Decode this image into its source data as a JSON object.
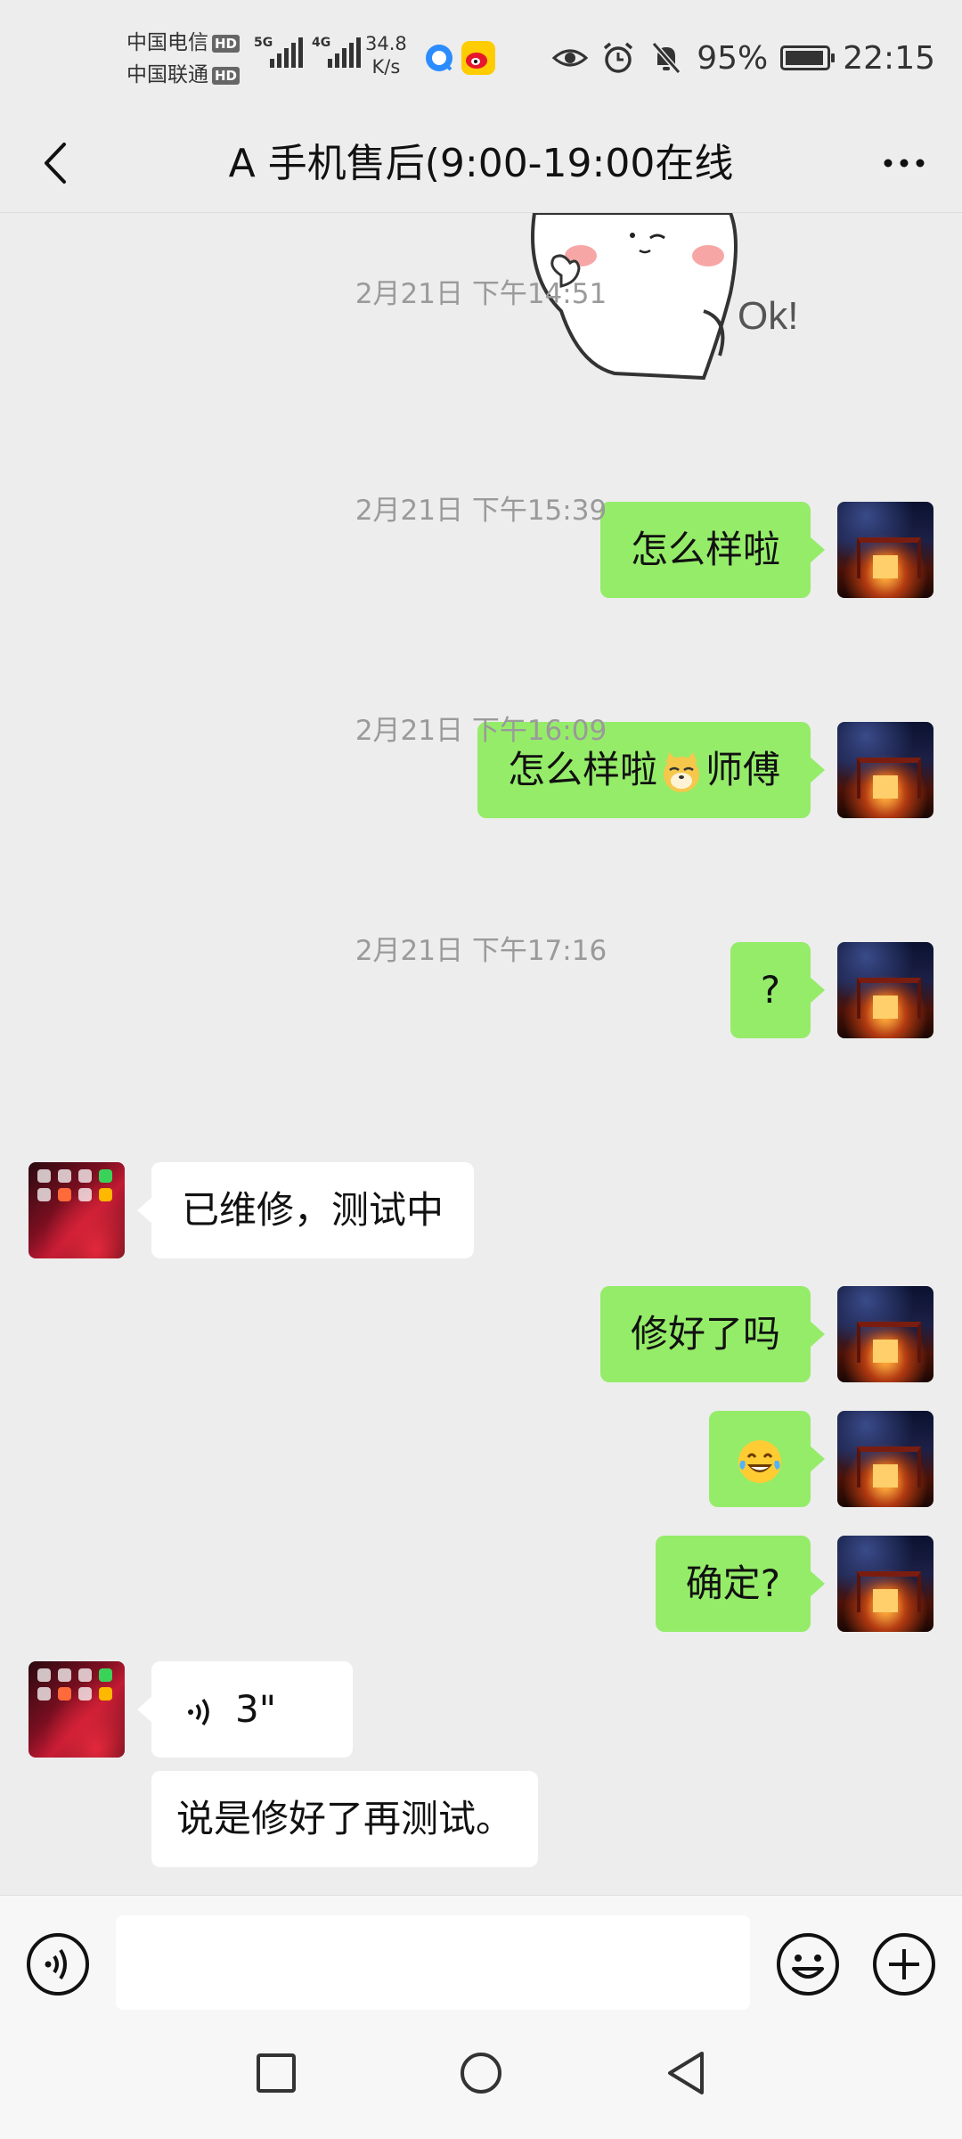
{
  "status_bar": {
    "carrier_1": "中国电信",
    "carrier_2": "中国联通",
    "hd_badge": "HD",
    "net_1": "5G",
    "net_2": "4G",
    "speed_value": "34.8",
    "speed_unit": "K/s",
    "battery_percent": "95%",
    "battery_level": 0.95,
    "time": "22:15",
    "icons": [
      "eye-icon",
      "alarm-icon",
      "mute-icon",
      "battery-icon"
    ]
  },
  "header": {
    "title": "A 手机售后(9:00-19:00在线",
    "back_icon": "back-chevron-icon",
    "more_icon": "more-dots-icon"
  },
  "messages": [
    {
      "type": "sticker",
      "sender": "other",
      "sticker_text": "Ok!"
    },
    {
      "type": "timestamp",
      "text": "2月21日 下午14:51"
    },
    {
      "type": "text",
      "sender": "me",
      "text": "怎么样啦"
    },
    {
      "type": "timestamp",
      "text": "2月21日 下午15:39"
    },
    {
      "type": "text",
      "sender": "me",
      "text_before": "怎么样啦",
      "emoji": "doge",
      "text_after": "师傅"
    },
    {
      "type": "timestamp",
      "text": "2月21日 下午16:09"
    },
    {
      "type": "text",
      "sender": "me",
      "text": "?"
    },
    {
      "type": "timestamp",
      "text": "2月21日 下午17:16"
    },
    {
      "type": "text",
      "sender": "other",
      "text": "已维修，测试中"
    },
    {
      "type": "text",
      "sender": "me",
      "text": "修好了吗"
    },
    {
      "type": "emoji",
      "sender": "me",
      "emoji": "laughing-tears"
    },
    {
      "type": "text",
      "sender": "me",
      "text": "确定?"
    },
    {
      "type": "voice",
      "sender": "other",
      "duration": "3\""
    },
    {
      "type": "text",
      "sender": "other",
      "text": "说是修好了再测试。"
    }
  ],
  "input_bar": {
    "value": "",
    "placeholder": ""
  },
  "colors": {
    "background": "#ededed",
    "my_bubble": "#95ec69",
    "other_bubble": "#ffffff",
    "timestamp_text": "#9a9a9a"
  }
}
